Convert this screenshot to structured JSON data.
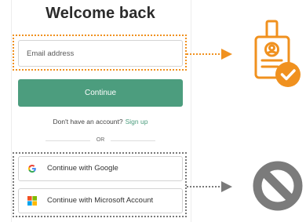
{
  "login": {
    "title": "Welcome back",
    "email_placeholder": "Email address",
    "continue_label": "Continue",
    "no_account_text": "Don't have an account?",
    "signup_label": "Sign up",
    "or_text": "OR",
    "google_label": "Continue with Google",
    "microsoft_label": "Continue with Microsoft Account"
  },
  "icons": {
    "email_result": "id-badge-check-icon",
    "social_result": "prohibited-icon"
  },
  "colors": {
    "accent_green": "#4c9d7e",
    "highlight_orange": "#f0911f",
    "highlight_gray": "#7a7a7a",
    "ban_gray": "#7b7b7b"
  }
}
